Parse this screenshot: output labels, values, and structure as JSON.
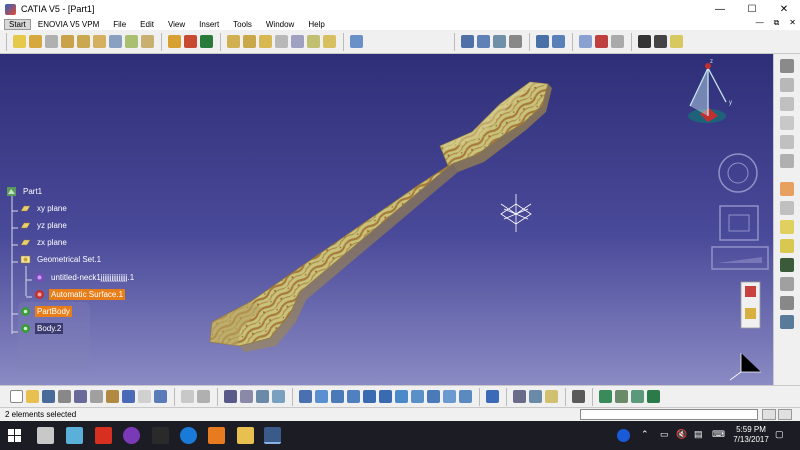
{
  "window": {
    "title": "CATIA V5 - [Part1]",
    "minimize": "—",
    "maximize": "☐",
    "close": "✕"
  },
  "menu": {
    "items": [
      "Start",
      "ENOVIA V5 VPM",
      "File",
      "Edit",
      "View",
      "Insert",
      "Tools",
      "Window",
      "Help"
    ],
    "doc_controls": [
      "—",
      "⧉",
      "✕"
    ]
  },
  "tree": {
    "root": "Part1",
    "items": [
      {
        "label": "xy plane",
        "icon": "plane-icon"
      },
      {
        "label": "yz plane",
        "icon": "plane-icon"
      },
      {
        "label": "zx plane",
        "icon": "plane-icon"
      },
      {
        "label": "Geometrical Set.1",
        "icon": "geometrical-set-icon"
      },
      {
        "label": "untitled-neck1jjjjjjjjjjjjjjj.1",
        "icon": "mesh-icon"
      },
      {
        "label": "Automatic Surface.1",
        "icon": "surface-icon"
      },
      {
        "label": "PartBody",
        "icon": "gear-body-icon"
      },
      {
        "label": "Body.2",
        "icon": "gear-body-icon"
      }
    ]
  },
  "status": {
    "message": "2 elements selected"
  },
  "taskbar": {
    "time": "5:59 PM",
    "date": "7/13/2017"
  },
  "colors": {
    "viewport_top": "#2e2e78",
    "viewport_bottom": "#8a8ac4",
    "model_base": "#c8c27a",
    "model_stripe": "#a87a3a",
    "selection": "#e87e1a"
  }
}
